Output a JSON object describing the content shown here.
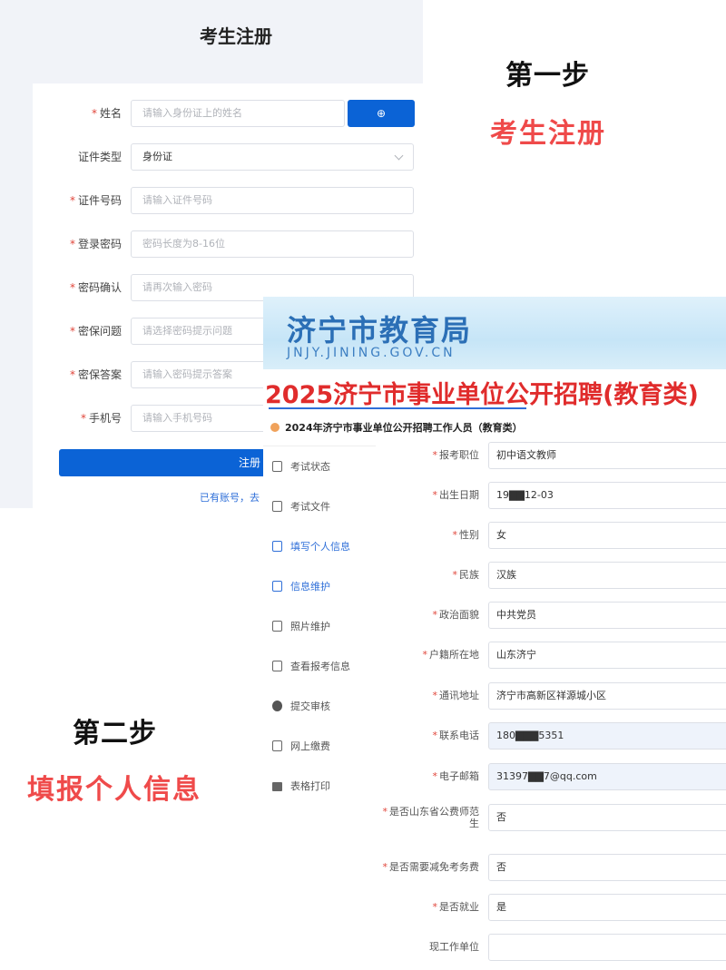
{
  "step1": {
    "title": "第一步",
    "subtitle": "考生注册"
  },
  "step2": {
    "title": "第二步",
    "subtitle": "填报个人信息"
  },
  "registration": {
    "page_title": "考生注册",
    "required_mark": "*",
    "fields": [
      {
        "label": "姓名",
        "required": true,
        "placeholder": "请输入身份证上的姓名"
      },
      {
        "label": "证件类型",
        "required": false,
        "value": "身份证"
      },
      {
        "label": "证件号码",
        "required": true,
        "placeholder": "请输入证件号码"
      },
      {
        "label": "登录密码",
        "required": true,
        "placeholder": "密码长度为8-16位"
      },
      {
        "label": "密码确认",
        "required": true,
        "placeholder": "请再次输入密码"
      },
      {
        "label": "密保问题",
        "required": true,
        "placeholder": "请选择密码提示问题"
      },
      {
        "label": "密保答案",
        "required": true,
        "placeholder": "请输入密码提示答案"
      },
      {
        "label": "手机号",
        "required": true,
        "placeholder": "请输入手机号码"
      }
    ],
    "name_button_icon": "⊕",
    "submit_label": "注册",
    "login_link": "已有账号，去"
  },
  "application": {
    "banner_cn": "济宁市教育局",
    "banner_en": "JNJY.JINING.GOV.CN",
    "heading": "2025济宁市事业单位公开招聘(教育类)",
    "subtitle": "2024年济宁市事业单位公开招聘工作人员（教育类）",
    "menu": [
      {
        "label": "考试状态",
        "icon": "document-icon",
        "active": false
      },
      {
        "label": "考试文件",
        "icon": "file-icon",
        "active": false
      },
      {
        "label": "填写个人信息",
        "icon": "edit-icon",
        "active": true
      },
      {
        "label": "信息维护",
        "icon": "form-icon",
        "active": true
      },
      {
        "label": "照片维护",
        "icon": "photo-icon",
        "active": false
      },
      {
        "label": "查看报考信息",
        "icon": "user-card-icon",
        "active": false
      },
      {
        "label": "提交审核",
        "icon": "check-circle-icon",
        "active": false
      },
      {
        "label": "网上缴费",
        "icon": "payment-icon",
        "active": false
      },
      {
        "label": "表格打印",
        "icon": "printer-icon",
        "active": false
      }
    ],
    "form": [
      {
        "label": "报考职位",
        "required": true,
        "value": "初中语文教师"
      },
      {
        "label": "出生日期",
        "required": true,
        "value": "19▇▇12-03"
      },
      {
        "label": "性别",
        "required": true,
        "value": "女"
      },
      {
        "label": "民族",
        "required": true,
        "value": "汉族"
      },
      {
        "label": "政治面貌",
        "required": true,
        "value": "中共党员"
      },
      {
        "label": "户籍所在地",
        "required": true,
        "value": "山东济宁"
      },
      {
        "label": "通讯地址",
        "required": true,
        "value": "济宁市高新区祥源城小区"
      },
      {
        "label": "联系电话",
        "required": true,
        "value": "180▇▇▇5351"
      },
      {
        "label": "电子邮箱",
        "required": true,
        "value": "31397▇▇7@qq.com"
      },
      {
        "label": "是否山东省公费师范生",
        "required": true,
        "value": "否"
      },
      {
        "label": "是否需要减免考务费",
        "required": true,
        "value": "否"
      },
      {
        "label": "是否就业",
        "required": true,
        "value": "是"
      },
      {
        "label": "现工作单位",
        "required": false,
        "value": ""
      }
    ]
  }
}
